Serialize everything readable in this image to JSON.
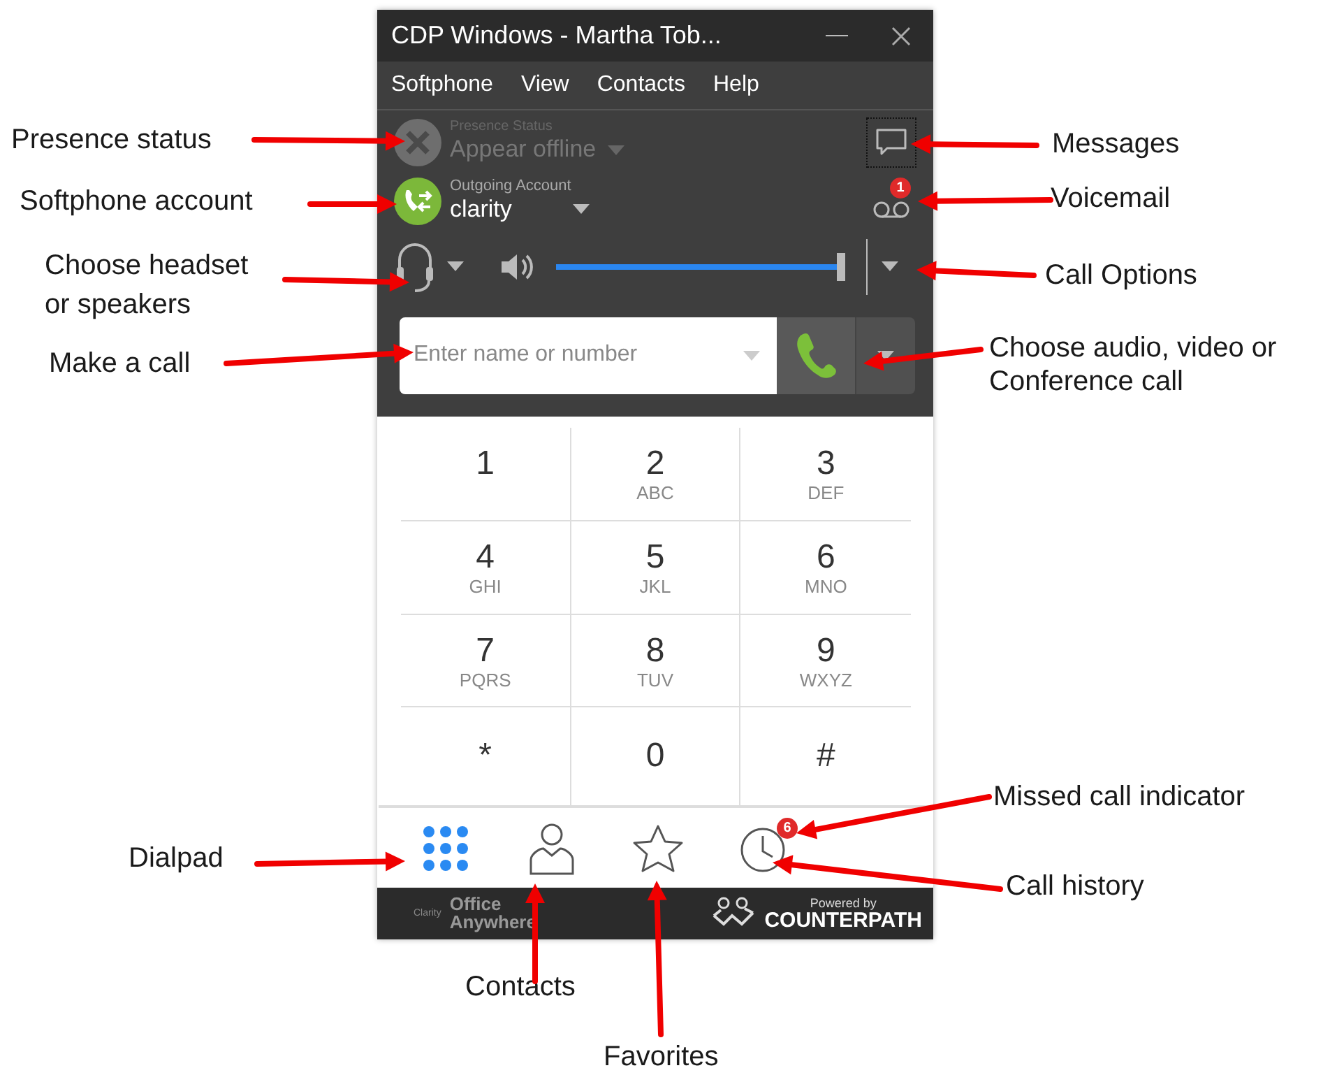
{
  "window": {
    "title": "CDP Windows - Martha Tob..."
  },
  "menu": [
    "Softphone",
    "View",
    "Contacts",
    "Help"
  ],
  "presence": {
    "label": "Presence Status",
    "value": "Appear offline",
    "disabled": true
  },
  "account": {
    "label": "Outgoing Account",
    "value": "clarity"
  },
  "voicemail": {
    "badge": "1"
  },
  "volume": {
    "level": 0.97
  },
  "call": {
    "placeholder": "Enter name or number"
  },
  "keypad": [
    {
      "digit": "1"
    },
    {
      "digit": "2",
      "letters": "ABC"
    },
    {
      "digit": "3",
      "letters": "DEF"
    },
    {
      "digit": "4",
      "letters": "GHI"
    },
    {
      "digit": "5",
      "letters": "JKL"
    },
    {
      "digit": "6",
      "letters": "MNO"
    },
    {
      "digit": "7",
      "letters": "PQRS"
    },
    {
      "digit": "8",
      "letters": "TUV"
    },
    {
      "digit": "9",
      "letters": "WXYZ"
    },
    {
      "digit": "*"
    },
    {
      "digit": "0"
    },
    {
      "digit": "#"
    }
  ],
  "nav": [
    {
      "kind": "dialpad",
      "selected": true
    },
    {
      "kind": "contacts",
      "selected": false
    },
    {
      "kind": "favorites",
      "selected": false
    },
    {
      "kind": "history",
      "selected": false,
      "badge": "6"
    }
  ],
  "footer": {
    "brand_small": "Clarity",
    "brand_line_1": "Office",
    "brand_line_2": "Anywhere",
    "powered": "Powered by",
    "company": "COUNTERPATH"
  },
  "annotations": [
    {
      "text": "Presence status"
    },
    {
      "text": "Softphone account"
    },
    {
      "text": "Choose headset\nor speakers"
    },
    {
      "text": "Make a call"
    },
    {
      "text": "Dialpad"
    },
    {
      "text": "Contacts"
    },
    {
      "text": "Favorites"
    },
    {
      "text": "Messages"
    },
    {
      "text": "Voicemail"
    },
    {
      "text": "Call Options"
    },
    {
      "text": "Choose audio, video or\nConference call"
    },
    {
      "text": "Missed call indicator"
    },
    {
      "text": "Call history"
    }
  ]
}
